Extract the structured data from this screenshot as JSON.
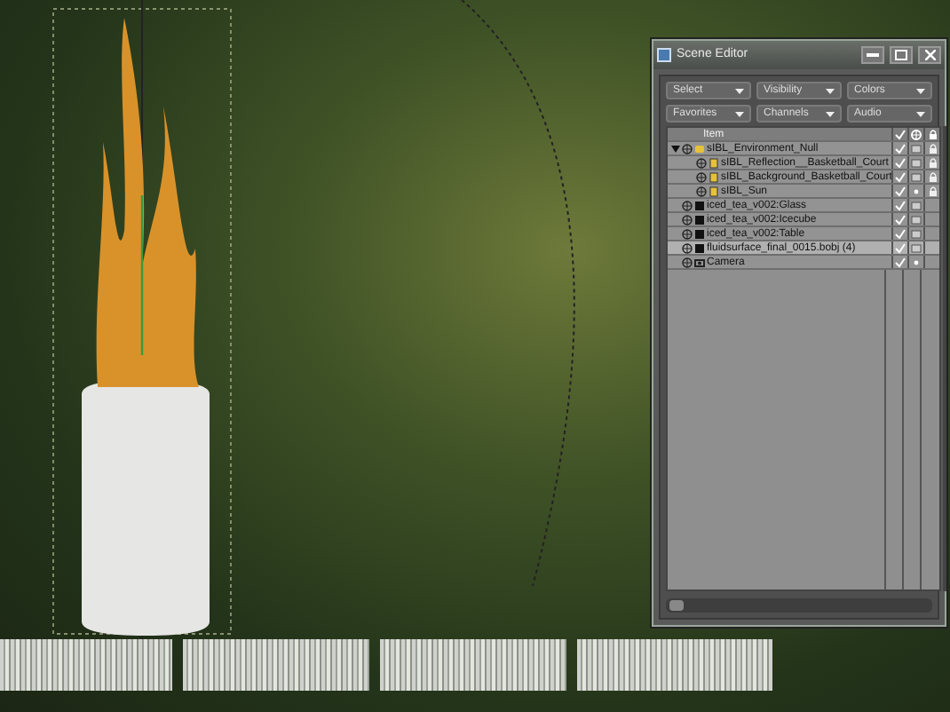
{
  "window": {
    "title": "Scene Editor"
  },
  "dropdowns": [
    {
      "label": "Select"
    },
    {
      "label": "Visibility"
    },
    {
      "label": "Colors"
    },
    {
      "label": "Favorites"
    },
    {
      "label": "Channels"
    },
    {
      "label": "Audio"
    }
  ],
  "table": {
    "columns": [
      "Item"
    ],
    "rows": [
      {
        "name": "sIBL_Environment_Null",
        "kind": "null",
        "expanded": true,
        "selected": false,
        "visible": true,
        "point_display": false,
        "locked": true,
        "children": [
          {
            "name": "sIBL_Reflection__Basketball_Court",
            "kind": "light",
            "selected": false,
            "visible": true,
            "point_display": false,
            "locked": true
          },
          {
            "name": "sIBL_Background_Basketball_Court",
            "kind": "light",
            "selected": false,
            "visible": true,
            "point_display": false,
            "locked": true
          },
          {
            "name": "sIBL_Sun",
            "kind": "light",
            "selected": false,
            "visible": true,
            "point_display": true,
            "locked": true
          }
        ]
      },
      {
        "name": "iced_tea_v002:Glass",
        "kind": "mesh",
        "selected": false,
        "visible": true,
        "point_display": false,
        "locked": false
      },
      {
        "name": "iced_tea_v002:Icecube",
        "kind": "mesh",
        "selected": false,
        "visible": true,
        "point_display": false,
        "locked": false
      },
      {
        "name": "iced_tea_v002:Table",
        "kind": "mesh",
        "selected": false,
        "visible": true,
        "point_display": false,
        "locked": false
      },
      {
        "name": "fluidsurface_final_0015.bobj (4)",
        "kind": "mesh",
        "selected": true,
        "visible": true,
        "point_display": false,
        "locked": false
      },
      {
        "name": "Camera",
        "kind": "camera",
        "selected": false,
        "visible": true,
        "point_display": true,
        "locked": false
      }
    ]
  }
}
